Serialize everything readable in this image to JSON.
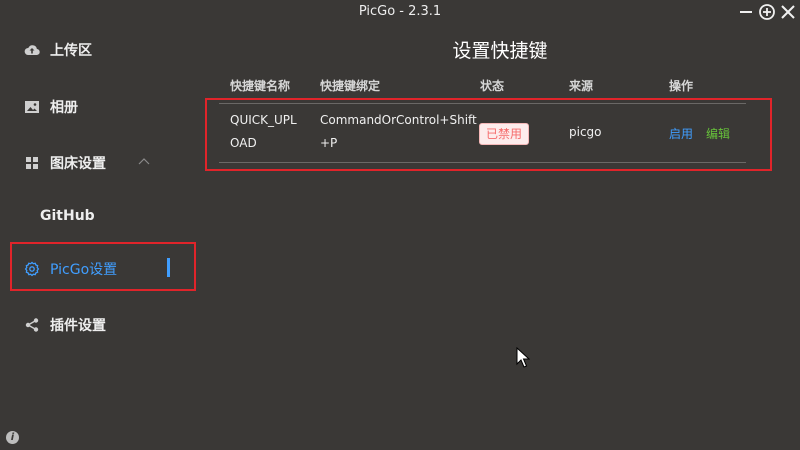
{
  "window": {
    "title": "PicGo - 2.3.1",
    "controls": [
      "minimize-icon",
      "maximize-icon",
      "close-icon"
    ]
  },
  "sidebar": {
    "items": [
      {
        "label": "上传区",
        "icon": "upload-cloud-icon"
      },
      {
        "label": "相册",
        "icon": "image-icon"
      },
      {
        "label": "图床设置",
        "icon": "grid-icon",
        "expanded": true
      },
      {
        "label": "GitHub"
      },
      {
        "label": "PicGo设置",
        "icon": "settings-gear-icon",
        "active": true
      },
      {
        "label": "插件设置",
        "icon": "share-icon"
      }
    ]
  },
  "main": {
    "title": "设置快捷键",
    "table": {
      "headers": [
        "快捷键名称",
        "快捷键绑定",
        "状态",
        "来源",
        "操作"
      ],
      "rows": [
        {
          "name_line1": "QUICK_UPL",
          "name_line2": "OAD",
          "binding_line1": "CommandOrControl+Shift",
          "binding_line2": "+P",
          "status": "已禁用",
          "source": "picgo",
          "action_enable": "启用",
          "action_edit": "编辑"
        }
      ]
    }
  },
  "colors": {
    "background": "#3a3836",
    "accent": "#409eff",
    "highlight_border": "#e0242a",
    "status_disabled": "#f56c6c",
    "edit_link": "#67c23a"
  }
}
